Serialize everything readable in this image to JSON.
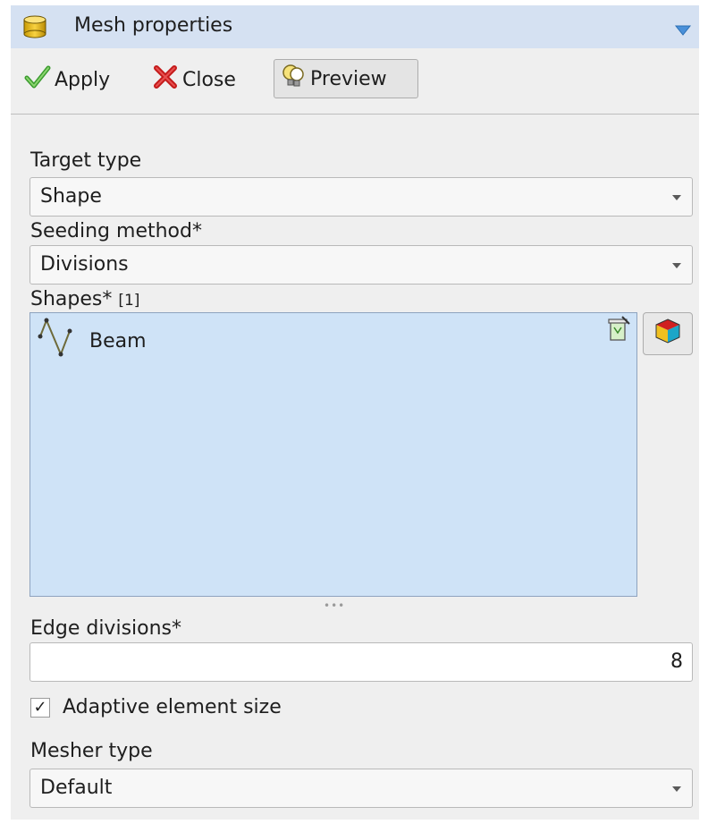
{
  "panel": {
    "title": "Mesh properties",
    "icons": {
      "title": "database-cylinder-icon",
      "collapse": "triangle-down-icon"
    }
  },
  "toolbar": {
    "apply_label": "Apply",
    "close_label": "Close",
    "preview_label": "Preview",
    "icons": {
      "apply": "checkmark-icon",
      "close": "red-x-icon",
      "preview": "lightbulb-icon"
    }
  },
  "form": {
    "target_type_label": "Target type",
    "target_type_value": "Shape",
    "seeding_label": "Seeding method*",
    "seeding_value": "Divisions",
    "shapes_label": "Shapes*",
    "shapes_count": "[1]",
    "shapes": [
      {
        "name": "Beam",
        "icon": "polyline-icon"
      }
    ],
    "edge_divisions_label": "Edge divisions*",
    "edge_divisions_value": "8",
    "adaptive_label": "Adaptive element size",
    "adaptive_checked": true,
    "mesher_label": "Mesher type",
    "mesher_value": "Default"
  }
}
